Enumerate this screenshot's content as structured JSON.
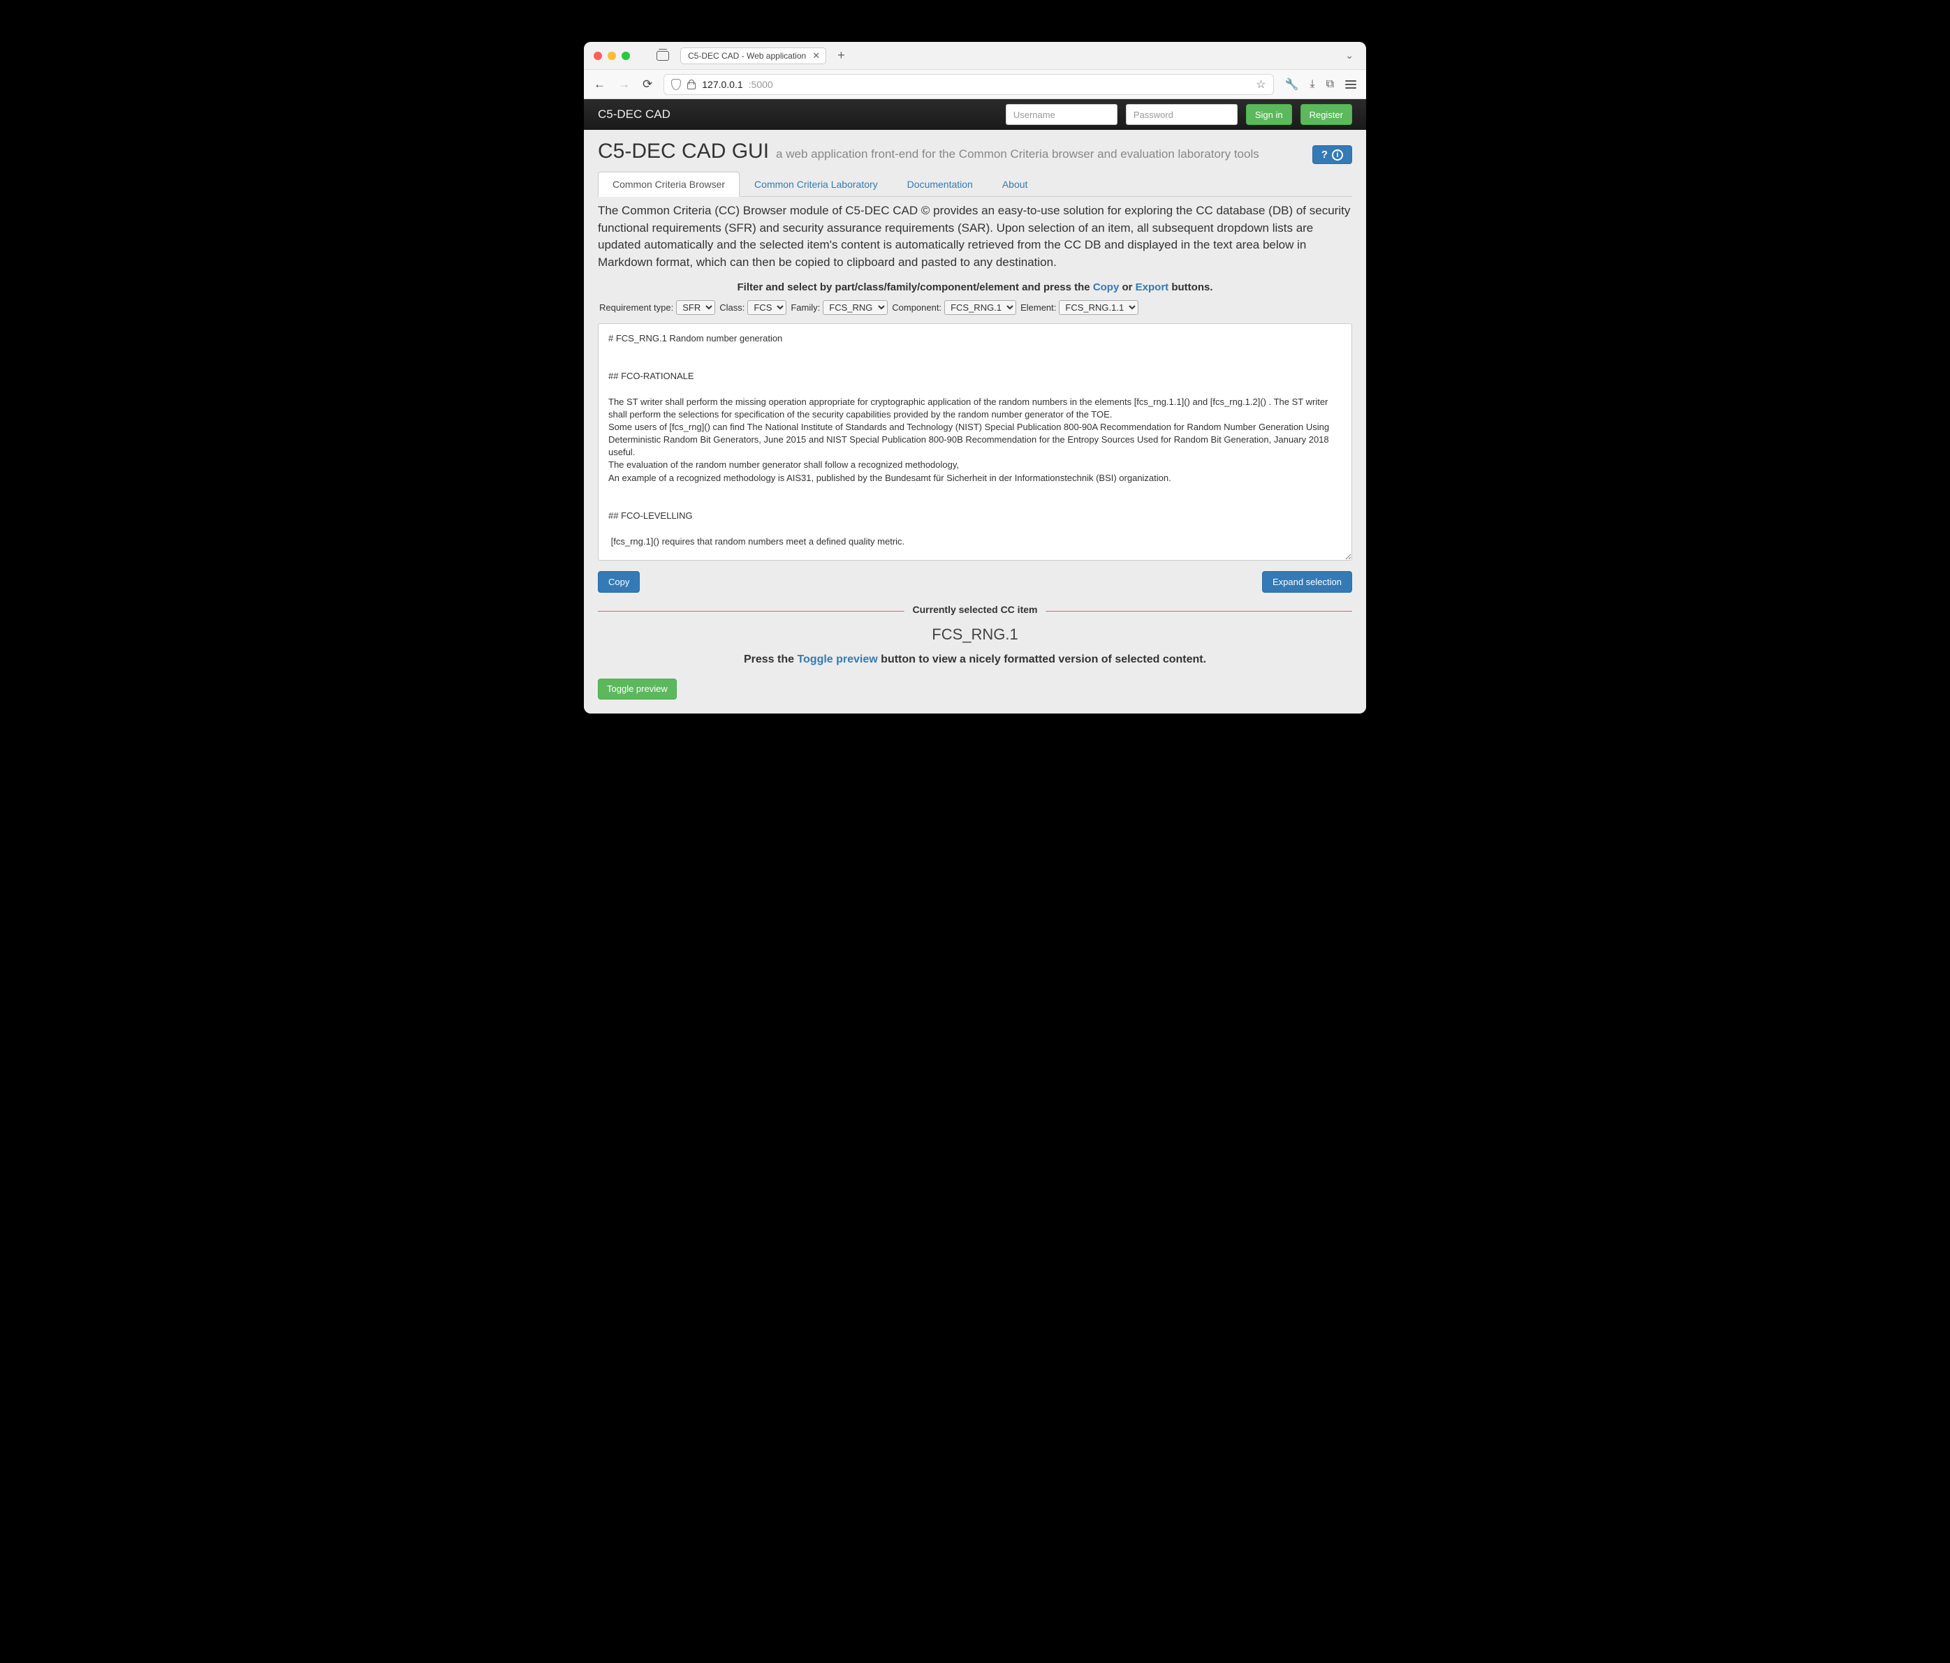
{
  "window": {
    "tab_title": "C5-DEC CAD - Web application"
  },
  "urlbar": {
    "host": "127.0.0.1",
    "port": ":5000"
  },
  "navbar": {
    "brand": "C5-DEC CAD",
    "username_placeholder": "Username",
    "password_placeholder": "Password",
    "signin": "Sign in",
    "register": "Register"
  },
  "header": {
    "title": "C5-DEC CAD GUI",
    "subtitle": "a web application front-end for the Common Criteria browser and evaluation laboratory tools",
    "help_q": "?",
    "help_i": "i"
  },
  "tabs": {
    "browser": "Common Criteria Browser",
    "lab": "Common Criteria Laboratory",
    "docs": "Documentation",
    "about": "About"
  },
  "intro": "The Common Criteria (CC) Browser module of C5-DEC CAD © provides an easy-to-use solution for exploring the CC database (DB) of security functional requirements (SFR) and security assurance requirements (SAR). Upon selection of an item, all subsequent dropdown lists are updated automatically and the selected item's content is automatically retrieved from the CC DB and displayed in the text area below in Markdown format, which can then be copied to clipboard and pasted to any destination.",
  "filter_line": {
    "prefix": "Filter and select by part/class/family/component/element and press the ",
    "copy": "Copy",
    "or": " or ",
    "export": "Export",
    "suffix": " buttons."
  },
  "selectors": {
    "req_type_label": "Requirement type:",
    "req_type_value": "SFR",
    "class_label": "Class:",
    "class_value": "FCS",
    "family_label": "Family:",
    "family_value": "FCS_RNG",
    "component_label": "Component:",
    "component_value": "FCS_RNG.1",
    "element_label": "Element:",
    "element_value": "FCS_RNG.1.1"
  },
  "textarea_value": "# FCS_RNG.1 Random number generation\n\n\n## FCO-RATIONALE\n\nThe ST writer shall perform the missing operation appropriate for cryptographic application of the random numbers in the elements [fcs_rng.1.1]() and [fcs_rng.1.2]() . The ST writer shall perform the selections for specification of the security capabilities provided by the random number generator of the TOE.\nSome users of [fcs_rng]() can find The National Institute of Standards and Technology (NIST) Special Publication 800-90A Recommendation for Random Number Generation Using Deterministic Random Bit Generators, June 2015 and NIST Special Publication 800-90B Recommendation for the Entropy Sources Used for Random Bit Generation, January 2018 useful.\nThe evaluation of the random number generator shall follow a recognized methodology,\nAn example of a recognized methodology is AIS31, published by the Bundesamt für Sicherheit in der Informationstechnik (BSI) organization.\n\n\n## FCO-LEVELLING\n\n [fcs_rng.1]() requires that random numbers meet a defined quality metric.",
  "actions": {
    "copy": "Copy",
    "expand": "Expand selection"
  },
  "selected": {
    "legend": "Currently selected CC item",
    "id": "FCS_RNG.1",
    "hint_prefix": "Press the ",
    "hint_link": "Toggle preview",
    "hint_suffix": " button to view a nicely formatted version of selected content."
  },
  "toggle_preview": "Toggle preview"
}
